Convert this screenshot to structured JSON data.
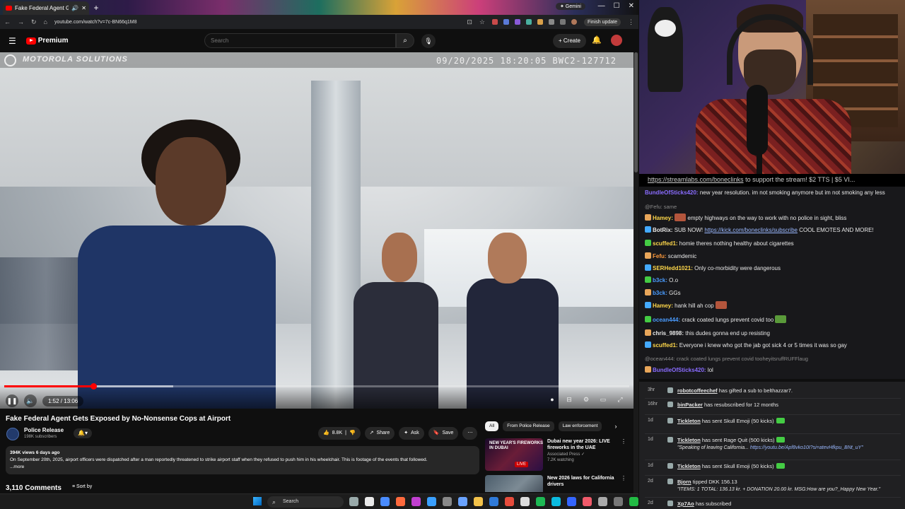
{
  "browser": {
    "tab_title": "Fake Federal Agent Gets Ex",
    "new_tab": "+",
    "gemini_label": "✦ Gemini",
    "url": "youtube.com/watch?v=7c-BN66q1M8",
    "finish_update": "Finish update",
    "window_controls": [
      "—",
      "☐",
      "✕"
    ]
  },
  "youtube": {
    "brand": "Premium",
    "search_placeholder": "Search",
    "create_label": "Create",
    "video": {
      "overlay_brand": "MOTOROLA SOLUTIONS",
      "timestamp_overlay": "09/20/2025 18:20:05 BWC2-127712",
      "time_display": "1:52 / 13:06",
      "progress_fraction": 0.1425,
      "buffered_fraction": 0.27
    },
    "title": "Fake Federal Agent Gets Exposed by No-Nonsense Cops at Airport",
    "channel": {
      "name": "Police Release",
      "subscribers": "198K subscribers"
    },
    "actions": {
      "likes": "8.8K",
      "share": "Share",
      "ask": "Ask",
      "save": "Save",
      "more": "⋯"
    },
    "description": {
      "meta": "394K views  6 days ago",
      "text": "On September 20th, 2025, airport officers were dispatched after a man reportedly threatened to strike airport staff when they refused to push him in his wheelchair. This is footage of the events that followed.",
      "more": "...more"
    },
    "comments_count": "3,110 Comments",
    "sort_label": "Sort by",
    "chips": [
      "All",
      "From Police Release",
      "Law enforcement"
    ],
    "related": [
      {
        "thumb_text": "NEW YEAR'S FIREWORKS IN DUBAI",
        "live_badge": "LIVE",
        "title": "Dubai new year 2026: LIVE fireworks in the UAE",
        "channel": "Associated Press ✓",
        "views": "7.2K watching"
      },
      {
        "title": "New 2026 laws for California drivers",
        "channel": "",
        "views": ""
      }
    ]
  },
  "chat": {
    "banner_link": "https://streamlabs.com/boneclinks",
    "banner_text": "to support the stream! $2 TTS | $5 VI...",
    "messages": [
      {
        "user": "BundleOfSticks420:",
        "color": "#8a6cff",
        "text": "new year resolution. im not smoking anymore but im not smoking any less"
      },
      {
        "reply": "@Fefu: same"
      },
      {
        "user": "Hamey:",
        "color": "#ffd84a",
        "text": "empty highways on the way to work with no police in sight, bliss"
      },
      {
        "user": "BotRix:",
        "color": "#e8e8e8",
        "text": "SUB NOW!",
        "link": "https://kick.com/boneclinks/subscribe",
        "text2": "COOL EMOTES AND MORE!"
      },
      {
        "user": "scuffed1:",
        "color": "#ffd84a",
        "text": "homie theres nothing healthy about cigarettes"
      },
      {
        "user": "Fefu:",
        "color": "#ff9a3c",
        "text": "scamdemic"
      },
      {
        "user": "SERHedd1021:",
        "color": "#ffd84a",
        "text": "Only co-morbidity were dangerous"
      },
      {
        "user": "b3ck:",
        "color": "#4a9cff",
        "text": "O.o"
      },
      {
        "user": "b3ck:",
        "color": "#4a9cff",
        "text": "GGs"
      },
      {
        "user": "Hamey:",
        "color": "#ffd84a",
        "text": "hank hill ah cop"
      },
      {
        "user": "ocean444:",
        "color": "#4a9cff",
        "text": "crack coated lungs prevent covid too"
      },
      {
        "user": "chris_9898:",
        "color": "#e8e8e8",
        "text": "this dudes gonna end up resisting"
      },
      {
        "user": "scuffed1:",
        "color": "#ffd84a",
        "text": "Everyone i knew who got the jab got sick 4 or 5 times it was so gay"
      },
      {
        "reply": "@ocean444: crack coated lungs prevent covid tooheyitsruffRUFFlaug"
      },
      {
        "user": "BundleOfSticks420:",
        "color": "#8a6cff",
        "text": "lol"
      }
    ]
  },
  "events": [
    {
      "time": "3hr",
      "user": "robotcoffeechef",
      "text": "has gifted a sub to belthazzar7."
    },
    {
      "time": "16hr",
      "user": "binPacker",
      "text": "has resubscribed for 12 months"
    },
    {
      "time": "1d",
      "user": "Tickleton",
      "text": "has sent Skull Emoji (50 kicks)"
    },
    {
      "time": "1d",
      "user": "Tickleton",
      "text": "has sent Rage Quit (500 kicks)",
      "sub": "\"Speaking of leaving California...",
      "sub_link": "https://youtu.be/Apf8vko10I?si=atevHfkpu_BNt_uY\""
    },
    {
      "time": "1d",
      "user": "Tickleton",
      "text": "has sent Skull Emoji (50 kicks)"
    },
    {
      "time": "2d",
      "user": "Bjorn",
      "text": "tipped DKK 156.13",
      "sub": "\"ITEMS: 1 TOTAL: 136.13 kr. + DONATION 20.00 kr. MSG:How are you?_Happy New Year.\""
    },
    {
      "time": "2d",
      "user": "Xp7Ao",
      "text": "has subscribed"
    }
  ],
  "taskbar": {
    "search_label": "Search",
    "icon_colors": [
      "#9aa",
      "#e9e9e9",
      "#4a8cff",
      "#ff6a3d",
      "#c13fd0",
      "#3aa0ff",
      "#888",
      "#6aa3ff",
      "#f3c24a",
      "#2f7ad8",
      "#e74c3c",
      "#ddd",
      "#1db954",
      "#0bbbe0",
      "#3465ff",
      "#f05a6a",
      "#aaa",
      "#777",
      "#22bb44"
    ]
  }
}
